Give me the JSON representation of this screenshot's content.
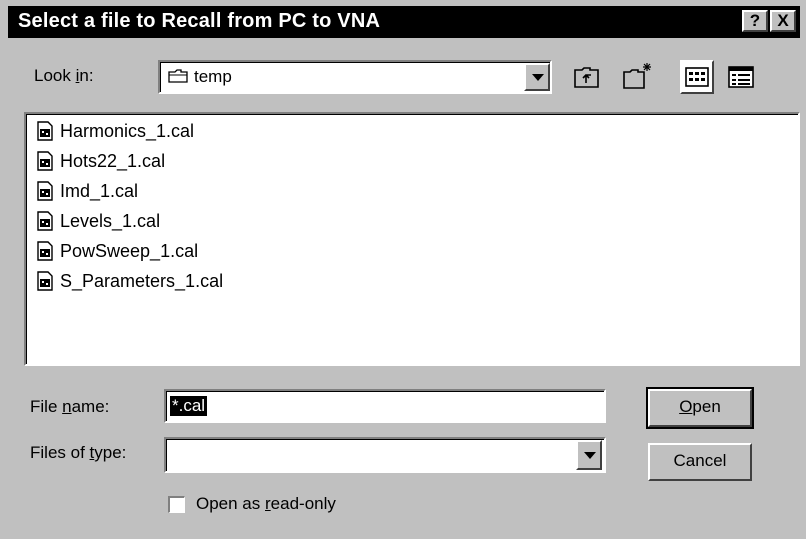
{
  "window": {
    "title": "Select a file to Recall from PC to VNA",
    "help_label": "?",
    "close_label": "X"
  },
  "look_in": {
    "label_pre": "Look ",
    "label_key": "i",
    "label_post": "n:",
    "value": "temp"
  },
  "toolbar": {
    "up_one_level_icon": "folder-up-icon",
    "new_folder_icon": "new-folder-icon",
    "list_view_icon": "list-view-icon",
    "details_view_icon": "details-view-icon"
  },
  "files": [
    {
      "name": "Harmonics_1.cal"
    },
    {
      "name": "Hots22_1.cal"
    },
    {
      "name": "Imd_1.cal"
    },
    {
      "name": "Levels_1.cal"
    },
    {
      "name": "PowSweep_1.cal"
    },
    {
      "name": "S_Parameters_1.cal"
    }
  ],
  "file_name": {
    "label_pre": "File ",
    "label_key": "n",
    "label_post": "ame:",
    "value": "*.cal"
  },
  "files_of_type": {
    "label_pre": "Files of ",
    "label_key": "t",
    "label_post": "ype:",
    "value": ""
  },
  "buttons": {
    "open_key": "O",
    "open_rest": "pen",
    "cancel": "Cancel"
  },
  "read_only": {
    "label_pre": "Open as ",
    "label_key": "r",
    "label_post": "ead-only",
    "checked": false
  }
}
